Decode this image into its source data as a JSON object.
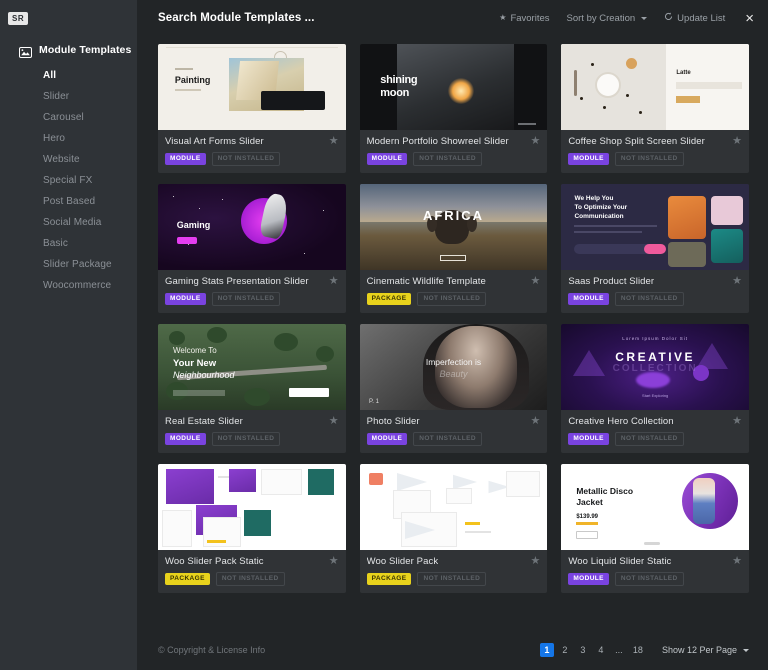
{
  "sidebar": {
    "logo_text": "SR",
    "logo_name": "sr-logo",
    "nav_header": {
      "label": "Module Templates",
      "icon": "image-icon"
    },
    "items": [
      {
        "label": "All",
        "active": true
      },
      {
        "label": "Slider",
        "active": false
      },
      {
        "label": "Carousel",
        "active": false
      },
      {
        "label": "Hero",
        "active": false
      },
      {
        "label": "Website",
        "active": false
      },
      {
        "label": "Special FX",
        "active": false
      },
      {
        "label": "Post Based",
        "active": false
      },
      {
        "label": "Social Media",
        "active": false
      },
      {
        "label": "Basic",
        "active": false
      },
      {
        "label": "Slider Package",
        "active": false
      },
      {
        "label": "Woocommerce",
        "active": false
      }
    ]
  },
  "topbar": {
    "search_value": "Search Module Templates ...",
    "search_placeholder": "Search Module Templates ...",
    "favorites_label": "Favorites",
    "favorites_icon": "star-icon",
    "sort_label": "Sort by Creation",
    "sort_icon": "chevron-down-icon",
    "update_label": "Update List",
    "update_icon": "refresh-icon",
    "close_icon": "close-icon",
    "close_label": "×"
  },
  "colors": {
    "accent_module": "#7a43e0",
    "accent_package": "#e8d21c",
    "accent_page_active": "#1576e8",
    "sidebar_bg": "#2f3337",
    "main_bg": "#222527",
    "card_bg": "#303336"
  },
  "cards": [
    {
      "title": "Visual Art Forms Slider",
      "badge": "MODULE",
      "badge_type": "module",
      "status": "NOT INSTALLED",
      "fav_icon": "star-icon",
      "art": "painting"
    },
    {
      "title": "Modern Portfolio Showreel Slider",
      "badge": "MODULE",
      "badge_type": "module",
      "status": "NOT INSTALLED",
      "fav_icon": "star-icon",
      "art": "moon"
    },
    {
      "title": "Coffee Shop Split Screen Slider",
      "badge": "MODULE",
      "badge_type": "module",
      "status": "NOT INSTALLED",
      "fav_icon": "star-icon",
      "art": "coffee"
    },
    {
      "title": "Gaming Stats Presentation Slider",
      "badge": "MODULE",
      "badge_type": "module",
      "status": "NOT INSTALLED",
      "fav_icon": "star-icon",
      "art": "gaming"
    },
    {
      "title": "Cinematic Wildlife Template",
      "badge": "PACKAGE",
      "badge_type": "package",
      "status": "NOT INSTALLED",
      "fav_icon": "star-icon",
      "art": "africa"
    },
    {
      "title": "Saas Product Slider",
      "badge": "MODULE",
      "badge_type": "module",
      "status": "NOT INSTALLED",
      "fav_icon": "star-icon",
      "art": "saas"
    },
    {
      "title": "Real Estate Slider",
      "badge": "MODULE",
      "badge_type": "module",
      "status": "NOT INSTALLED",
      "fav_icon": "star-icon",
      "art": "estate"
    },
    {
      "title": "Photo Slider",
      "badge": "MODULE",
      "badge_type": "module",
      "status": "NOT INSTALLED",
      "fav_icon": "star-icon",
      "art": "photo"
    },
    {
      "title": "Creative Hero Collection",
      "badge": "MODULE",
      "badge_type": "module",
      "status": "NOT INSTALLED",
      "fav_icon": "star-icon",
      "art": "creative"
    },
    {
      "title": "Woo Slider Pack Static",
      "badge": "PACKAGE",
      "badge_type": "package",
      "status": "NOT INSTALLED",
      "fav_icon": "star-icon",
      "art": "woo1"
    },
    {
      "title": "Woo Slider Pack",
      "badge": "PACKAGE",
      "badge_type": "package",
      "status": "NOT INSTALLED",
      "fav_icon": "star-icon",
      "art": "woo2"
    },
    {
      "title": "Woo Liquid Slider Static",
      "badge": "MODULE",
      "badge_type": "module",
      "status": "NOT INSTALLED",
      "fav_icon": "star-icon",
      "art": "metal"
    }
  ],
  "thumb_text": {
    "painting_kicker": "",
    "painting_title": "Painting",
    "moon_line1": "shining",
    "moon_line2": "moon",
    "coffee_title": "Latte",
    "gaming_title": "Gaming",
    "africa_title": "AFRICA",
    "saas_title": "We Help You\nTo Optimize Your\nCommunication",
    "estate_line1": "Welcome To",
    "estate_line2": "Your New",
    "estate_line3": "Neighbourhood",
    "photo_line1": "Imperfection is",
    "photo_line2": "Beauty",
    "photo_num": "P. 1",
    "creative_top": "Lorem Ipsum Dolor Sit",
    "creative_title": "CREATIVE",
    "creative_sub": "COLLECTION",
    "creative_bottom": "Start Exploring",
    "metal_title": "Metallic Disco\nJacket",
    "metal_price": "$139.99"
  },
  "footer": {
    "copyright": "© Copyright & License Info",
    "pages": [
      "1",
      "2",
      "3",
      "4",
      "...",
      "18"
    ],
    "active_page": "1",
    "per_page_label": "Show 12 Per Page",
    "per_page_icon": "chevron-down-icon"
  }
}
